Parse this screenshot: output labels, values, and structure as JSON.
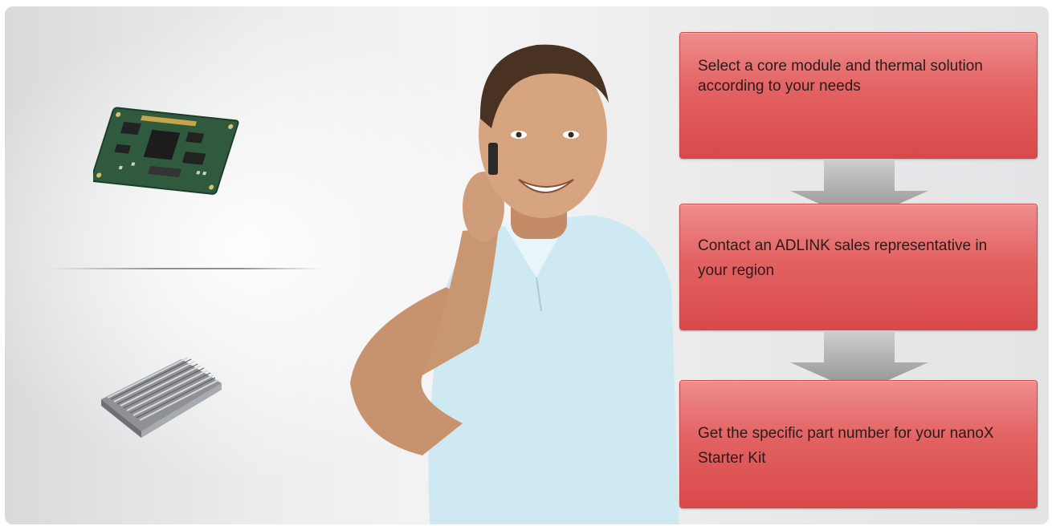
{
  "steps": [
    {
      "text": "Select a core module and thermal solution according to your needs"
    },
    {
      "text": "Contact an ADLINK sales representative in your region"
    },
    {
      "text": "Get the specific part number for your nanoX Starter Kit"
    }
  ],
  "colors": {
    "step_fill": "#e36262",
    "step_border": "#c84a4a",
    "arrow": "#9a9a9a",
    "background": "#ececec"
  },
  "icons": [
    "module-board-icon",
    "heatsink-icon",
    "down-arrow-icon"
  ]
}
